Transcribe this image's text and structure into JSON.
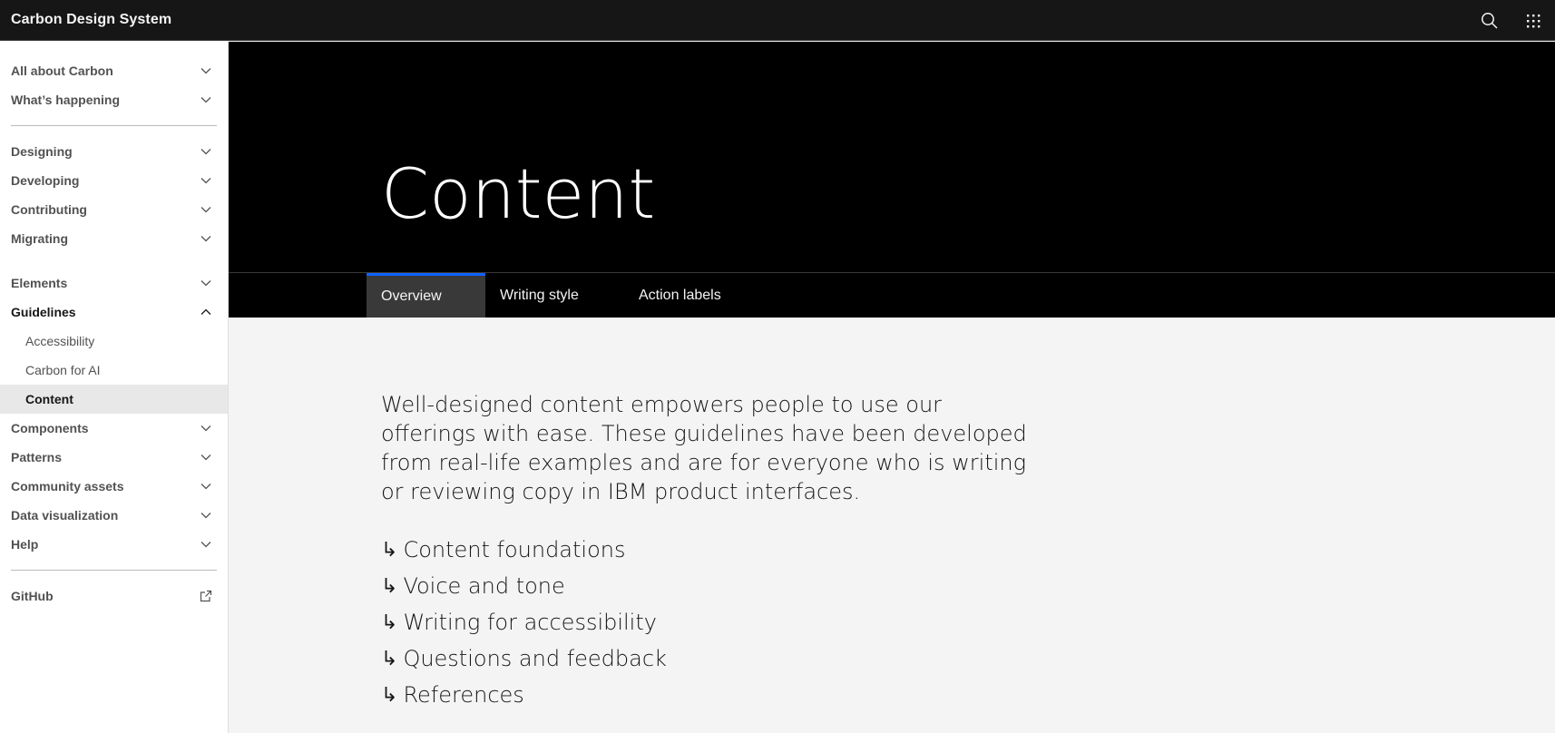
{
  "header": {
    "title": "Carbon Design System"
  },
  "sidebar": {
    "group1": [
      {
        "label": "All about Carbon"
      },
      {
        "label": "What’s happening"
      }
    ],
    "group2": [
      {
        "label": "Designing"
      },
      {
        "label": "Developing"
      },
      {
        "label": "Contributing"
      },
      {
        "label": "Migrating"
      }
    ],
    "group3": {
      "elements": {
        "label": "Elements"
      },
      "guidelines": {
        "label": "Guidelines",
        "children": [
          {
            "label": "Accessibility"
          },
          {
            "label": "Carbon for AI"
          },
          {
            "label": "Content"
          }
        ]
      },
      "rest": [
        {
          "label": "Components"
        },
        {
          "label": "Patterns"
        },
        {
          "label": "Community assets"
        },
        {
          "label": "Data visualization"
        },
        {
          "label": "Help"
        }
      ]
    },
    "github": {
      "label": "GitHub"
    }
  },
  "hero": {
    "title": "Content"
  },
  "tabs": [
    {
      "label": "Overview",
      "active": true
    },
    {
      "label": "Writing style"
    },
    {
      "label": "Action labels"
    }
  ],
  "main": {
    "lead": "Well-designed content empowers people to use our offerings with ease. These guidelines have been developed from real-life examples and are for everyone who is writing or reviewing copy in IBM product interfaces.",
    "anchor_arrow": "↳",
    "anchors": [
      {
        "label": "Content foundations"
      },
      {
        "label": "Voice and tone"
      },
      {
        "label": "Writing for accessibility"
      },
      {
        "label": "Questions and feedback"
      },
      {
        "label": "References"
      }
    ]
  },
  "colors": {
    "header_bg": "#161616",
    "hero_bg": "#000000",
    "tab_active_border": "#0f62fe",
    "main_bg": "#f4f4f4"
  }
}
